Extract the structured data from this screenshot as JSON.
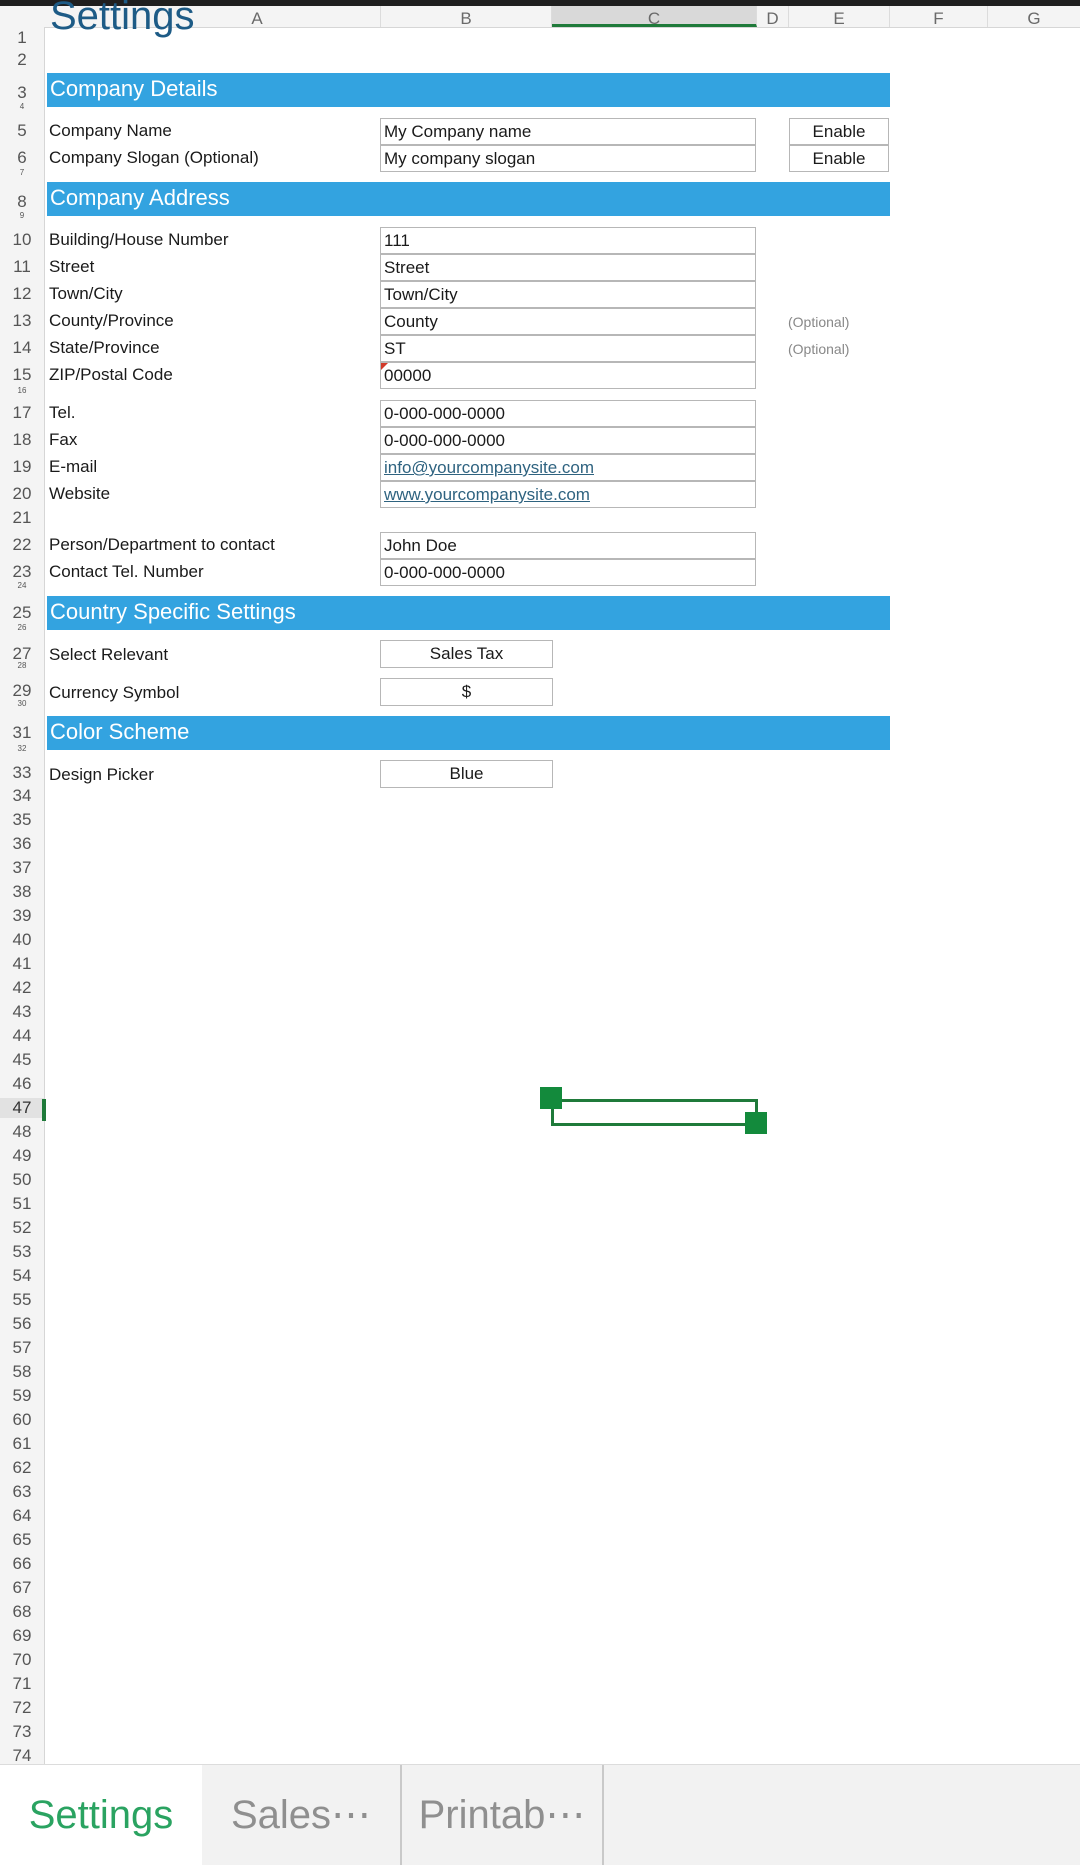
{
  "columns": [
    "A",
    "B",
    "C",
    "D",
    "E",
    "F",
    "G"
  ],
  "rows": [
    "1",
    "2",
    "3",
    "4",
    "5",
    "6",
    "7",
    "8",
    "9",
    "10",
    "11",
    "12",
    "13",
    "14",
    "15",
    "16",
    "17",
    "18",
    "19",
    "20",
    "21",
    "22",
    "23",
    "24",
    "25",
    "26",
    "27",
    "28",
    "29",
    "30",
    "31",
    "32",
    "33",
    "34",
    "35",
    "36",
    "37",
    "38",
    "39",
    "40",
    "41",
    "42",
    "43",
    "44",
    "45",
    "46",
    "47",
    "48",
    "49",
    "50",
    "51",
    "52",
    "53",
    "54",
    "55",
    "56",
    "57",
    "58",
    "59",
    "60",
    "61",
    "62",
    "63",
    "64",
    "65",
    "66",
    "67",
    "68",
    "69",
    "70",
    "71",
    "72",
    "73",
    "74"
  ],
  "sheet_title": "Settings",
  "sections": {
    "company_details": "Company Details",
    "company_address": "Company Address",
    "country_settings": "Country Specific Settings",
    "color_scheme": "Color Scheme"
  },
  "company": {
    "name_label": "Company Name",
    "name_value": "My Company name",
    "name_toggle": "Enable",
    "slogan_label": "Company Slogan (Optional)",
    "slogan_value": "My company slogan",
    "slogan_toggle": "Enable"
  },
  "address": {
    "building_label": "Building/House Number",
    "building_value": "111",
    "street_label": "Street",
    "street_value": "Street",
    "town_label": "Town/City",
    "town_value": "Town/City",
    "county_label": "County/Province",
    "county_value": "County",
    "county_note": "(Optional)",
    "state_label": "State/Province",
    "state_value": "ST",
    "state_note": "(Optional)",
    "zip_label": "ZIP/Postal Code",
    "zip_value": "00000"
  },
  "contact": {
    "tel_label": "Tel.",
    "tel_value": "0-000-000-0000",
    "fax_label": "Fax",
    "fax_value": "0-000-000-0000",
    "email_label": "E-mail",
    "email_value": "info@yourcompanysite.com",
    "website_label": "Website",
    "website_value": "www.yourcompanysite.com",
    "person_label": "Person/Department to contact",
    "person_value": "John Doe",
    "contact_tel_label": "Contact Tel. Number",
    "contact_tel_value": "0-000-000-0000"
  },
  "country": {
    "relevant_label": "Select Relevant",
    "relevant_value": "Sales Tax",
    "currency_label": "Currency Symbol",
    "currency_value": "$"
  },
  "design": {
    "picker_label": "Design Picker",
    "picker_value": "Blue"
  },
  "selection": {
    "active_row": "47",
    "active_column": "C"
  },
  "tabs": [
    "Settings",
    "Sales⋯",
    "Printab⋯"
  ],
  "colors": {
    "band": "#33a3e0",
    "accent_green": "#1f7a3a",
    "active_tab": "#2aa361",
    "title": "#1d5b86"
  }
}
